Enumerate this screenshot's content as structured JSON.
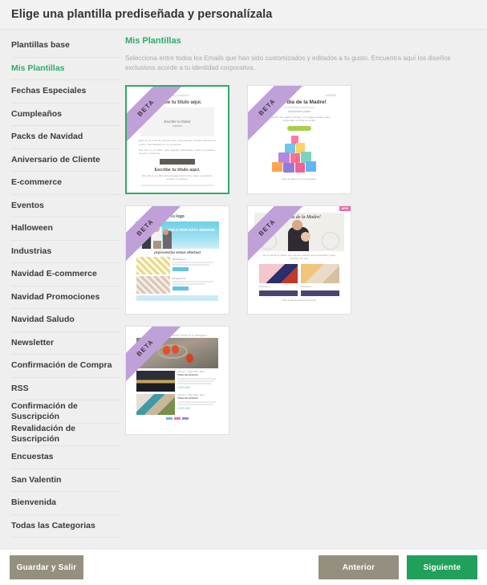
{
  "header": {
    "title": "Elige una plantilla prediseñada y personalízala"
  },
  "sidebar": {
    "items": [
      {
        "label": "Plantillas base",
        "active": false
      },
      {
        "label": "Mis Plantillas",
        "active": true
      },
      {
        "label": "Fechas Especiales",
        "active": false
      },
      {
        "label": "Cumpleaños",
        "active": false
      },
      {
        "label": "Packs de Navidad",
        "active": false
      },
      {
        "label": "Aniversario de Cliente",
        "active": false
      },
      {
        "label": "E-commerce",
        "active": false
      },
      {
        "label": "Eventos",
        "active": false
      },
      {
        "label": "Halloween",
        "active": false
      },
      {
        "label": "Industrias",
        "active": false
      },
      {
        "label": "Navidad E-commerce",
        "active": false
      },
      {
        "label": "Navidad Promociones",
        "active": false
      },
      {
        "label": "Navidad Saludo",
        "active": false
      },
      {
        "label": "Newsletter",
        "active": false
      },
      {
        "label": "Confirmación de Compra",
        "active": false
      },
      {
        "label": "RSS",
        "active": false
      },
      {
        "label": "Confirmación de Suscripción",
        "active": false
      },
      {
        "label": "Revalidación de Suscripción",
        "active": false
      },
      {
        "label": "Encuestas",
        "active": false
      },
      {
        "label": "San Valentin",
        "active": false
      },
      {
        "label": "Bienvenida",
        "active": false
      },
      {
        "label": "Todas las Categorias",
        "active": false
      }
    ]
  },
  "content": {
    "title": "Mis Plantillas",
    "description": "Selecciona entre todos los Emails que han sido customizados y editados a tu gusto. Encuentra aquí los diseños exclusivos acorde a tu identidad corporativa.",
    "badge_label": "BETA",
    "cards": [
      {
        "id": "card-blank-title",
        "selected": true,
        "logo": "nombre y empresa",
        "title": "Escribe tu título aquí.",
        "inner_title": "Escribe tu titular",
        "inner_sub": "subtítulo",
        "cta": "",
        "title2": "Escribe tu título aquí.",
        "body1": "Este es un texto de ejemplo para esta plantilla, puedes editarlo a tu gusto y reemplazarlo con tu contenido.",
        "body2": "Haz clic en el editor para agregar información sobre tu producto, servicio o empresa.",
        "body3": "Haz clic en el editor para agregar información sobre tu producto, servicio o empresa."
      },
      {
        "id": "card-dia-madre-regalos",
        "selected": false,
        "logo": "LOGO",
        "title": "¡Feliz día de la Madre!",
        "subtitle": "Celebremos juntos",
        "body": "Descubre las mejores ofertas y los regalos ideales para sorprender a mamá en su día.",
        "cta": "Ver ofertas",
        "footer": "Date de baja | Ver en el navegador"
      },
      {
        "id": "card-tu-logo-promo",
        "selected": false,
        "logo": "Tu logo",
        "hero_text": "SOLO POR ESTA SEMANA",
        "section_title": "¡Aprovecha estas ofertas!",
        "products": [
          {
            "name": "Producto 1",
            "cta": "Comprar"
          },
          {
            "name": "Producto 2",
            "cta": "Comprar"
          }
        ],
        "footer_cta": "Ver todos los productos"
      },
      {
        "id": "card-dia-madre-foto",
        "selected": false,
        "badge": "NEW",
        "title": "Feliz día de la Madre!",
        "body": "En el día de la madre, las mejores ofertas para consentirla y para celebrar con ella.",
        "products": [
          {
            "name": "Producto 1",
            "cta": "COMPRAR"
          },
          {
            "name": "Producto 2",
            "cta": "COMPRAR"
          }
        ],
        "footer": "Date de baja de esta lista de correos"
      },
      {
        "id": "card-newsletter-fotos",
        "selected": false,
        "preheader": "¿No puedes ver este email? Míralo en tu navegador",
        "articles": [
          {
            "kicker": "Artículo 1 · Mayo 2021 · Blog",
            "title": "Título del artículo",
            "link": "LEER MÁS"
          },
          {
            "kicker": "Artículo 2 · Mayo 2021 · Blog",
            "title": "Título del artículo",
            "link": "LEER MÁS"
          }
        ]
      }
    ]
  },
  "footer": {
    "save_label": "Guardar y Salir",
    "prev_label": "Anterior",
    "next_label": "Siguiente"
  },
  "colors": {
    "accent_green": "#2dab66",
    "button_green": "#20a05a",
    "button_muted": "#948f7e",
    "ribbon_purple": "#c0a0d8",
    "page_bg": "#efefef"
  }
}
